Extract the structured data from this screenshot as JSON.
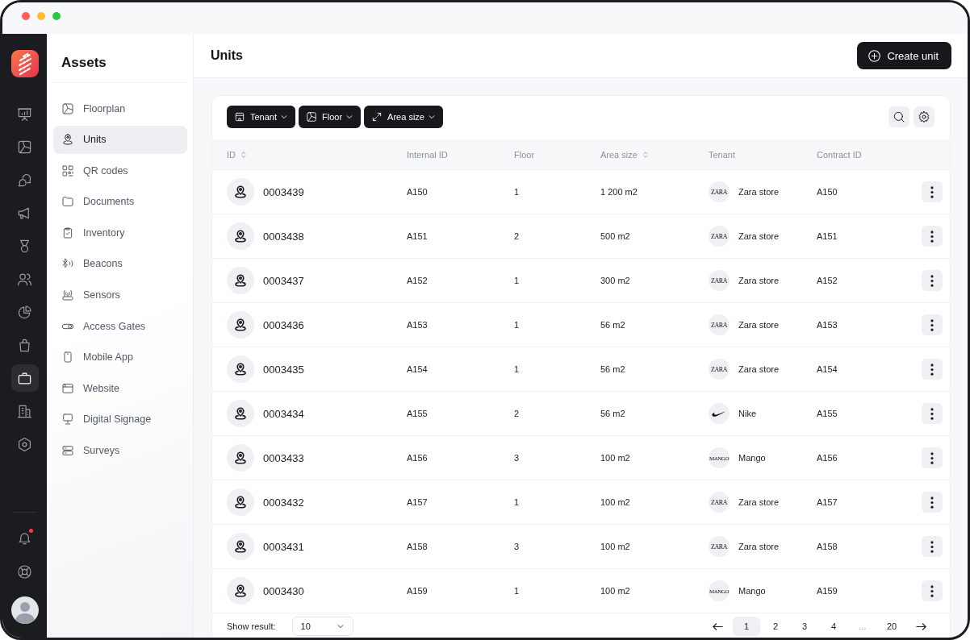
{
  "rail": {
    "items": [
      {
        "selected": false
      },
      {
        "selected": false
      },
      {
        "selected": false
      },
      {
        "selected": false
      },
      {
        "selected": false
      },
      {
        "selected": false
      },
      {
        "selected": false
      },
      {
        "selected": false
      },
      {
        "selected": true
      },
      {
        "selected": false
      },
      {
        "selected": false
      }
    ],
    "notifications": {
      "unread": true
    }
  },
  "sidebar": {
    "title": "Assets",
    "items": [
      {
        "label": "Floorplan",
        "selected": false
      },
      {
        "label": "Units",
        "selected": true
      },
      {
        "label": "QR codes",
        "selected": false
      },
      {
        "label": "Documents",
        "selected": false
      },
      {
        "label": "Inventory",
        "selected": false
      },
      {
        "label": "Beacons",
        "selected": false
      },
      {
        "label": "Sensors",
        "selected": false
      },
      {
        "label": "Access Gates",
        "selected": false
      },
      {
        "label": "Mobile App",
        "selected": false
      },
      {
        "label": "Website",
        "selected": false
      },
      {
        "label": "Digital Signage",
        "selected": false
      },
      {
        "label": "Surveys",
        "selected": false
      }
    ]
  },
  "header": {
    "title": "Units",
    "create_button": "Create unit"
  },
  "toolbar": {
    "filters": [
      {
        "label": "Tenant"
      },
      {
        "label": "Floor"
      },
      {
        "label": "Area size"
      }
    ]
  },
  "table": {
    "columns": [
      {
        "label": "ID",
        "sortable": true
      },
      {
        "label": "Internal ID",
        "sortable": false
      },
      {
        "label": "Floor",
        "sortable": false
      },
      {
        "label": "Area size",
        "sortable": true
      },
      {
        "label": "Tenant",
        "sortable": false
      },
      {
        "label": "Contract ID",
        "sortable": false
      }
    ],
    "rows": [
      {
        "id": "0003439",
        "internal_id": "A150",
        "floor": "1",
        "area": "1 200 m2",
        "tenant": {
          "name": "Zara store",
          "logo": {
            "kind": "wordmark",
            "text": "ZARA"
          }
        },
        "contract_id": "A150"
      },
      {
        "id": "0003438",
        "internal_id": "A151",
        "floor": "2",
        "area": "500 m2",
        "tenant": {
          "name": "Zara store",
          "logo": {
            "kind": "wordmark",
            "text": "ZARA"
          }
        },
        "contract_id": "A151"
      },
      {
        "id": "0003437",
        "internal_id": "A152",
        "floor": "1",
        "area": "300 m2",
        "tenant": {
          "name": "Zara store",
          "logo": {
            "kind": "wordmark",
            "text": "ZARA"
          }
        },
        "contract_id": "A152"
      },
      {
        "id": "0003436",
        "internal_id": "A153",
        "floor": "1",
        "area": "56 m2",
        "tenant": {
          "name": "Zara store",
          "logo": {
            "kind": "wordmark",
            "text": "ZARA"
          }
        },
        "contract_id": "A153"
      },
      {
        "id": "0003435",
        "internal_id": "A154",
        "floor": "1",
        "area": "56 m2",
        "tenant": {
          "name": "Zara store",
          "logo": {
            "kind": "wordmark",
            "text": "ZARA"
          }
        },
        "contract_id": "A154"
      },
      {
        "id": "0003434",
        "internal_id": "A155",
        "floor": "2",
        "area": "56 m2",
        "tenant": {
          "name": "Nike",
          "logo": {
            "kind": "swoosh"
          }
        },
        "contract_id": "A155"
      },
      {
        "id": "0003433",
        "internal_id": "A156",
        "floor": "3",
        "area": "100 m2",
        "tenant": {
          "name": "Mango",
          "logo": {
            "kind": "wordmark",
            "text": "MANGO"
          }
        },
        "contract_id": "A156"
      },
      {
        "id": "0003432",
        "internal_id": "A157",
        "floor": "1",
        "area": "100 m2",
        "tenant": {
          "name": "Zara store",
          "logo": {
            "kind": "wordmark",
            "text": "ZARA"
          }
        },
        "contract_id": "A157"
      },
      {
        "id": "0003431",
        "internal_id": "A158",
        "floor": "3",
        "area": "100 m2",
        "tenant": {
          "name": "Zara store",
          "logo": {
            "kind": "wordmark",
            "text": "ZARA"
          }
        },
        "contract_id": "A158"
      },
      {
        "id": "0003430",
        "internal_id": "A159",
        "floor": "1",
        "area": "100 m2",
        "tenant": {
          "name": "Mango",
          "logo": {
            "kind": "wordmark",
            "text": "MANGO"
          }
        },
        "contract_id": "A159"
      }
    ]
  },
  "footer": {
    "show_result_label": "Show result:",
    "page_size": "10",
    "pages": [
      {
        "kind": "page",
        "label": "1",
        "selected": true
      },
      {
        "kind": "page",
        "label": "2",
        "selected": false
      },
      {
        "kind": "page",
        "label": "3",
        "selected": false
      },
      {
        "kind": "page",
        "label": "4",
        "selected": false
      },
      {
        "kind": "gap",
        "label": "..."
      },
      {
        "kind": "page",
        "label": "20",
        "selected": false
      }
    ]
  }
}
